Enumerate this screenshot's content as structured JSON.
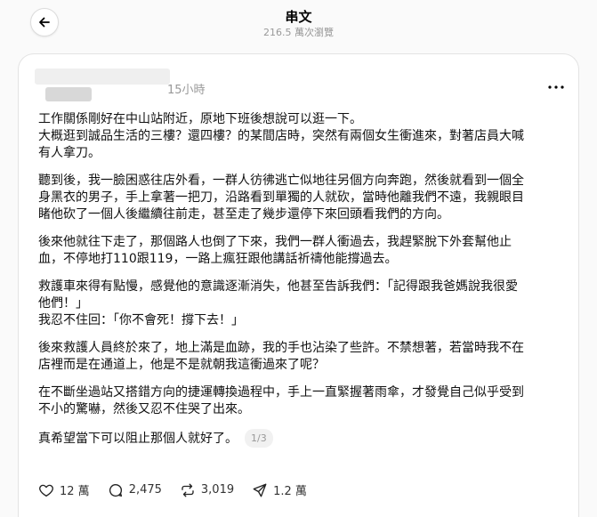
{
  "header": {
    "title": "串文",
    "views": "216.5 萬次瀏覽"
  },
  "post": {
    "time": "15小時",
    "paragraphs": [
      [
        "工作關係剛好在中山站附近，原地下班後想說可以逛一下。",
        "大概逛到誠品生活的三樓？還四樓？的某間店時，突然有兩個女生衝進來，對著店員大喊",
        "有人拿刀。"
      ],
      [
        "聽到後，我一臉困惑往店外看，一群人彷彿逃亡似地往另個方向奔跑，然後就看到一個全",
        "身黑衣的男子，手上拿著一把刀，沿路看到單獨的人就砍，當時他離我們不遠，我親眼目",
        "睹他砍了一個人後繼續往前走，甚至走了幾步還停下來回頭看我們的方向。"
      ],
      [
        "後來他就往下走了，那個路人也倒了下來，我們一群人衝過去，我趕緊脫下外套幫他止",
        "血，不停地打110跟119，一路上瘋狂跟他講話祈禱他能撐過去。"
      ],
      [
        "救護車來得有點慢，感覺他的意識逐漸消失，他甚至告訴我們：「記得跟我爸媽說我很愛",
        "他們！」",
        "我忍不住回：「你不會死！撐下去！」"
      ],
      [
        "後來救護人員終於來了，地上滿是血跡，我的手也沾染了些許。不禁想著，若當時我不在",
        "店裡而是在通道上，他是不是就朝我這衝過來了呢？"
      ],
      [
        "在不斷坐過站又搭錯方向的捷運轉換過程中，手上一直緊握著雨傘，才發覺自己似乎受到",
        "不小的驚嚇，然後又忍不住哭了出來。"
      ]
    ],
    "last_line": "真希望當下可以阻止那個人就好了。",
    "page_indicator": "1/3",
    "actions": {
      "likes": "12 萬",
      "comments": "2,475",
      "reposts": "3,019",
      "shares": "1.2 萬"
    }
  }
}
